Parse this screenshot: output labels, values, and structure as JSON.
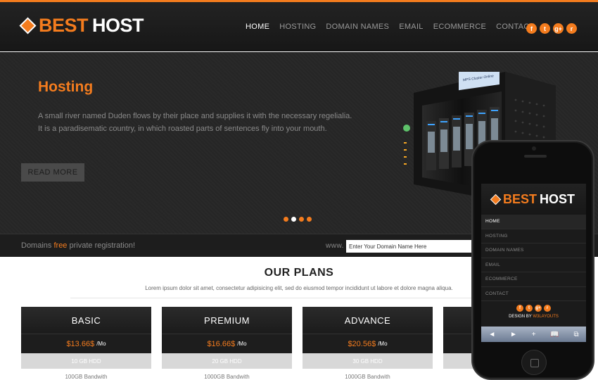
{
  "header": {
    "logo_word1": "BEST",
    "logo_word2": "HOST",
    "nav": [
      "HOME",
      "HOSTING",
      "DOMAIN NAMES",
      "EMAIL",
      "ECOMMERCE",
      "CONTACT"
    ],
    "social_icons": [
      "facebook-icon",
      "twitter-icon",
      "google-plus-icon",
      "rss-icon"
    ],
    "social_glyphs": [
      "f",
      "t",
      "g+",
      "r"
    ]
  },
  "hero": {
    "title": "Hosting",
    "text": "A small river named Duden flows by their place and supplies it with the necessary regelialia. It is a paradisematic country, in which roasted parts of sentences fly into your mouth.",
    "button": "READ MORE",
    "slide_count": 4,
    "active_slide": 1,
    "server_labels": [
      "MPS Cluster Online"
    ]
  },
  "domain": {
    "prefix": "Domains",
    "free": "free",
    "suffix": "private registration!",
    "www_label": "www.",
    "input_placeholder": "Enter Your Domain Name Here"
  },
  "plans": {
    "title": "OUR PLANS",
    "subtitle": "Lorem ipsum dolor sit amet, consectetur adipisicing elit, sed do eiusmod tempor incididunt ut labore et dolore magna aliqua.",
    "items": [
      {
        "name": "BASIC",
        "price": "$13.66$",
        "per": "/Mo",
        "storage": "10 GB HDD",
        "bandwidth": "100GB Bandwith"
      },
      {
        "name": "PREMIUM",
        "price": "$16.66$",
        "per": "/Mo",
        "storage": "20 GB HDD",
        "bandwidth": "1000GB Bandwith"
      },
      {
        "name": "ADVANCE",
        "price": "$20.56$",
        "per": "/Mo",
        "storage": "30 GB HDD",
        "bandwidth": "1000GB Bandwith"
      },
      {
        "name": "",
        "price": "",
        "per": "",
        "storage": "",
        "bandwidth": ""
      }
    ]
  },
  "mobile": {
    "logo_word1": "BEST",
    "logo_word2": "HOST",
    "nav": [
      "HOME",
      "HOSTING",
      "DOMAIN NAMES",
      "EMAIL",
      "ECOMMERCE",
      "CONTACT"
    ],
    "design_by": "DESIGN BY",
    "design_link": "W3LAYOUTS",
    "toolbar": [
      "◄",
      "►",
      "+",
      "📖",
      "⧉"
    ]
  },
  "colors": {
    "accent": "#f47c1e",
    "dark": "#1d1d1d"
  }
}
